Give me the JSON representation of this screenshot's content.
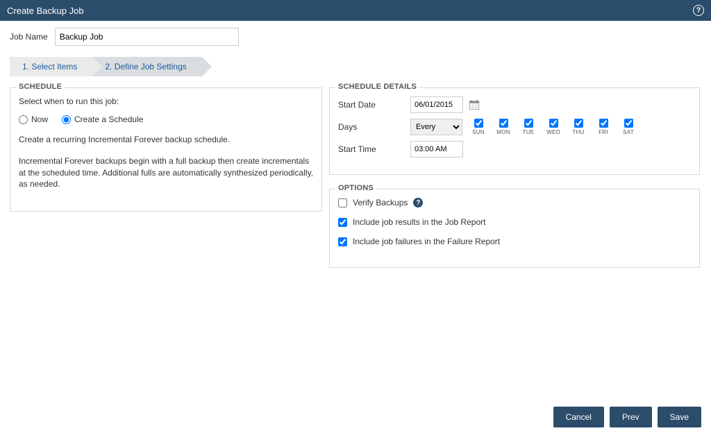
{
  "dialog": {
    "title": "Create Backup Job"
  },
  "jobname": {
    "label": "Job Name",
    "value": "Backup Job"
  },
  "steps": {
    "s1": "1. Select Items",
    "s2": "2. Define Job Settings"
  },
  "schedule": {
    "legend": "SCHEDULE",
    "instr": "Select when to run this job:",
    "radio_now": "Now",
    "radio_sched": "Create a Schedule",
    "desc1": "Create a recurring Incremental Forever backup schedule.",
    "desc2": "Incremental Forever backups begin with a full backup then create incrementals at the scheduled time. Additional fulls are automatically synthesized periodically, as needed."
  },
  "details": {
    "legend": "SCHEDULE DETAILS",
    "startdate_label": "Start Date",
    "startdate_value": "06/01/2015",
    "days_label": "Days",
    "days_select": "Every",
    "day_names": [
      "SUN",
      "MON",
      "TUE",
      "WED",
      "THU",
      "FRI",
      "SAT"
    ],
    "starttime_label": "Start Time",
    "starttime_value": "03:00 AM"
  },
  "options": {
    "legend": "OPTIONS",
    "verify": "Verify Backups",
    "results": "Include job results in the Job Report",
    "failures": "Include job failures in the Failure Report"
  },
  "footer": {
    "cancel": "Cancel",
    "prev": "Prev",
    "save": "Save"
  }
}
